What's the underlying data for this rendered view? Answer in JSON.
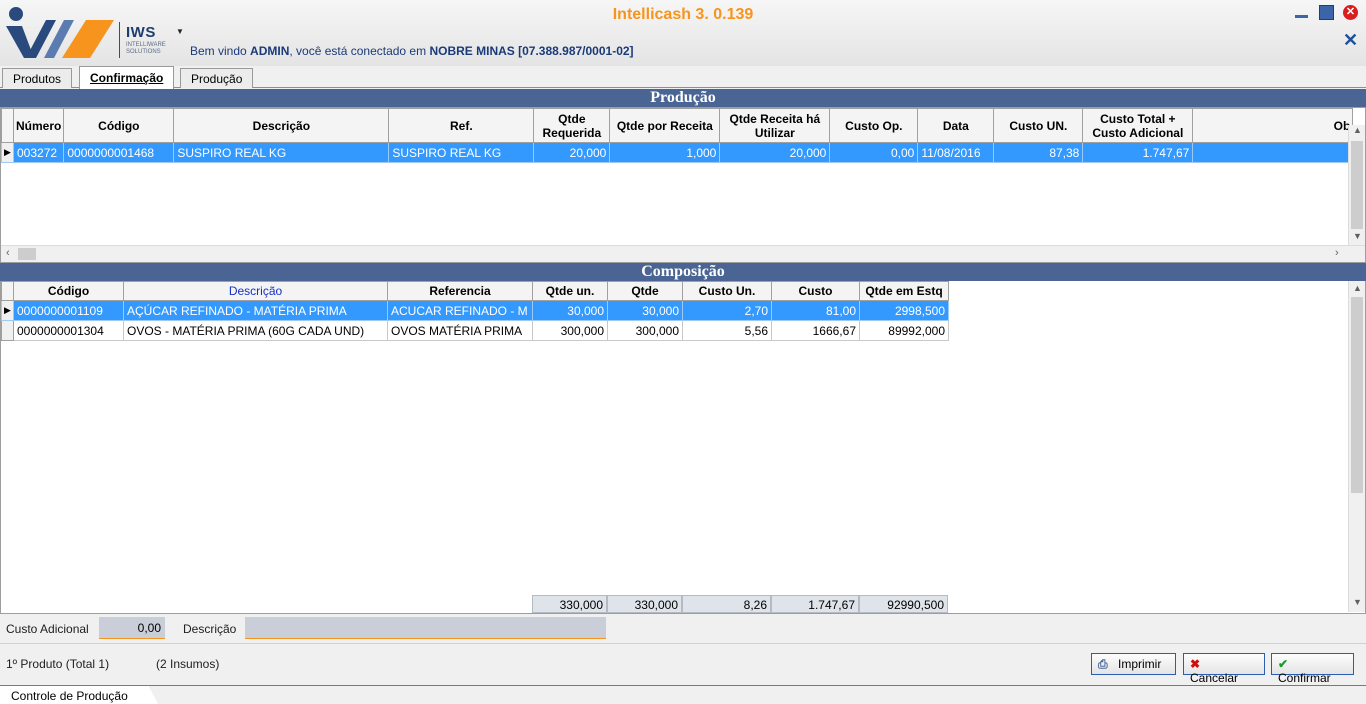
{
  "app": {
    "title": "Intellicash 3. 0.139",
    "logo_text": "IWS",
    "logo_sub": "INTELLIWARE SOLUTIONS",
    "welcome_prefix": "Bem vindo ",
    "user": "ADMIN",
    "welcome_middle": ", você está conectado em ",
    "company": "NOBRE MINAS [07.388.987/0001-02]"
  },
  "tabs": [
    {
      "label": "Produtos",
      "active": false
    },
    {
      "label": "Confirmação",
      "active": true
    },
    {
      "label": "Produção",
      "active": false
    }
  ],
  "producao": {
    "title": "Produção",
    "headers": [
      "Número",
      "Código",
      "Descrição",
      "Ref.",
      "Qtde Requerida",
      "Qtde por Receita",
      "Qtde Receita há Utilizar",
      "Custo Op.",
      "Data",
      "Custo UN.",
      "Custo Total + Custo Adicional",
      "Ob"
    ],
    "rows": [
      [
        "003272",
        "0000000001468",
        "SUSPIRO REAL KG",
        "SUSPIRO REAL KG",
        "20,000",
        "1,000",
        "20,000",
        "0,00",
        "11/08/2016",
        "87,38",
        "1.747,67",
        ""
      ]
    ]
  },
  "composicao": {
    "title": "Composição",
    "headers": [
      "Código",
      "Descrição",
      "Referencia",
      "Qtde un.",
      "Qtde",
      "Custo Un.",
      "Custo",
      "Qtde em Estq"
    ],
    "rows": [
      [
        "0000000001109",
        "AÇÚCAR REFINADO - MATÉRIA PRIMA",
        "ACUCAR REFINADO - M",
        "30,000",
        "30,000",
        "2,70",
        "81,00",
        "2998,500"
      ],
      [
        "0000000001304",
        "OVOS - MATÉRIA PRIMA (60G CADA UND)",
        "OVOS MATÉRIA PRIMA",
        "300,000",
        "300,000",
        "5,56",
        "1666,67",
        "89992,000"
      ]
    ],
    "totals": [
      "330,000",
      "330,000",
      "8,26",
      "1.747,67",
      "92990,500"
    ]
  },
  "form": {
    "custo_adicional_label": "Custo Adicional",
    "custo_adicional_value": "0,00",
    "descricao_label": "Descrição",
    "descricao_value": ""
  },
  "status": {
    "produto": "1º Produto (Total 1)",
    "insumos": "(2 Insumos)"
  },
  "buttons": {
    "imprimir": "Imprimir",
    "cancelar": "Cancelar",
    "confirmar": "Confirmar"
  },
  "bottom_tab": "Controle de Produção",
  "colors": {
    "accent": "#f7941d",
    "panel": "#4a6594",
    "selection": "#3399ff"
  }
}
